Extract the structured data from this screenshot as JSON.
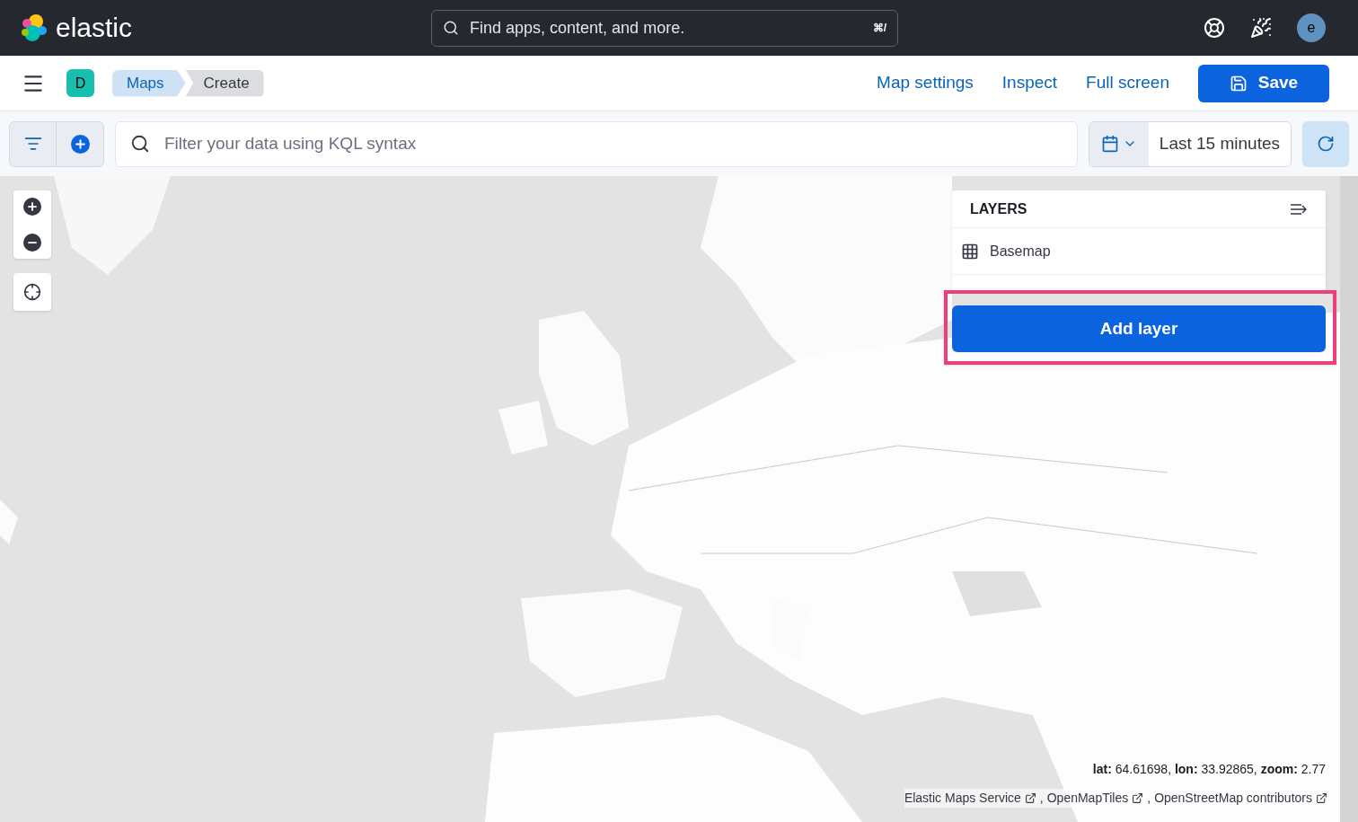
{
  "header": {
    "brand": "elastic",
    "search": {
      "placeholder": "Find apps, content, and more.",
      "shortcut": "⌘/"
    },
    "avatar": "e"
  },
  "app_bar": {
    "space": "D",
    "breadcrumbs": [
      {
        "label": "Maps",
        "selected": true
      },
      {
        "label": "Create",
        "selected": false
      }
    ],
    "links": [
      "Map settings",
      "Inspect",
      "Full screen"
    ],
    "save": "Save"
  },
  "query_bar": {
    "placeholder": "Filter your data using KQL syntax",
    "time_range": "Last 15 minutes"
  },
  "map": {
    "layers_panel": {
      "title": "LAYERS",
      "layers": [
        {
          "name": "Basemap"
        }
      ],
      "add_layer": "Add layer",
      "highlighted": true
    },
    "coordinates": "**lat:** 64.61698, **lon:** 33.92865, **zoom:** 2.77",
    "attribution": [
      "Elastic Maps Service",
      "OpenMapTiles",
      "OpenStreetMap contributors"
    ],
    "attribution_separator": ","
  }
}
